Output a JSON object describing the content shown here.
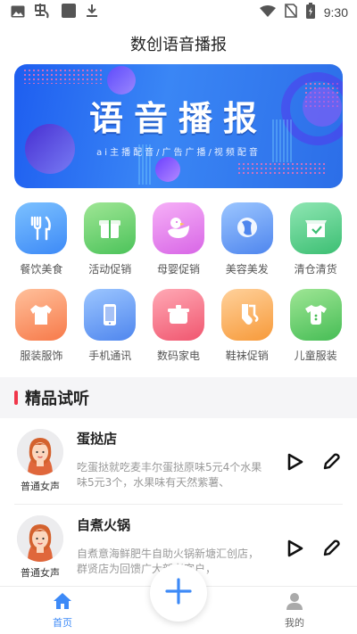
{
  "status_bar": {
    "time": "9:30",
    "left_icons": [
      "image-icon",
      "chinese-char-icon",
      "square-icon",
      "download-icon"
    ],
    "right_icons": [
      "wifi-icon",
      "no-sim-icon",
      "battery-charging-icon"
    ]
  },
  "header": {
    "title": "数创语音播报"
  },
  "banner": {
    "title": "语音播报",
    "subtitle": "ai主播配音/广告广播/视频配音"
  },
  "categories": [
    {
      "label": "餐饮美食",
      "icon": "fork-knife-icon",
      "color_from": "#6fb6ff",
      "color_to": "#3d8af7"
    },
    {
      "label": "活动促销",
      "icon": "gift-box-icon",
      "color_from": "#8fe08a",
      "color_to": "#4cc35a"
    },
    {
      "label": "母婴促销",
      "icon": "duck-icon",
      "color_from": "#f4a4f5",
      "color_to": "#d866e6"
    },
    {
      "label": "美容美发",
      "icon": "hair-icon",
      "color_from": "#8cbcff",
      "color_to": "#4f86ee"
    },
    {
      "label": "清仓清货",
      "icon": "cart-box-icon",
      "color_from": "#7fe0a6",
      "color_to": "#3cbf73"
    },
    {
      "label": "服装服饰",
      "icon": "tshirt-icon",
      "color_from": "#ffb38a",
      "color_to": "#f77a4a"
    },
    {
      "label": "手机通讯",
      "icon": "phone-icon",
      "color_from": "#8cbcff",
      "color_to": "#4f86ee"
    },
    {
      "label": "数码家电",
      "icon": "pot-icon",
      "color_from": "#ff9aa8",
      "color_to": "#f0566f"
    },
    {
      "label": "鞋袜促销",
      "icon": "sock-icon",
      "color_from": "#ffc98a",
      "color_to": "#f79a3a"
    },
    {
      "label": "儿童服装",
      "icon": "baby-clothes-icon",
      "color_from": "#8fe08a",
      "color_to": "#46bd55"
    }
  ],
  "section": {
    "title": "精品试听"
  },
  "items": [
    {
      "title": "蛋挞店",
      "voice": "普通女声",
      "desc": "吃蛋挞就吃麦丰尔蛋挞原味5元4个水果味5元3个，水果味有天然紫薯、"
    },
    {
      "title": "自煮火锅",
      "voice": "普通女声",
      "desc": "自煮意海鲜肥牛自助火锅新塘汇创店，群贤店为回馈广大新老客户，"
    }
  ],
  "bottom_nav": {
    "home_label": "首页",
    "mine_label": "我的",
    "accent": "#3d8af7"
  }
}
